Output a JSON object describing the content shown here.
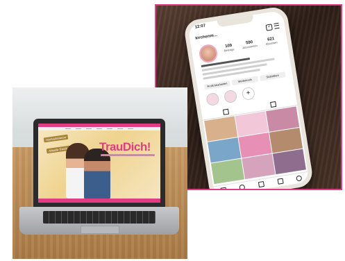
{
  "phone_photo": {
    "status_time": "12:07",
    "profile_handle": "kirchenm...",
    "stats": [
      {
        "value": "109",
        "label": "Beiträge"
      },
      {
        "value": "590",
        "label": "Abonnenten"
      },
      {
        "value": "621",
        "label": "Abonniert"
      }
    ],
    "buttons": [
      "Profil bearbeiten",
      "Werbetools",
      "Statistiken"
    ],
    "add_highlight_label": "+",
    "frame_color": "#e23d82"
  },
  "laptop_photo": {
    "brand_title": "TrauDich!",
    "badge_1": "Hochzeitsmesse",
    "badge_2": "Aktuelle Trends",
    "accent_color": "#e23d82"
  }
}
